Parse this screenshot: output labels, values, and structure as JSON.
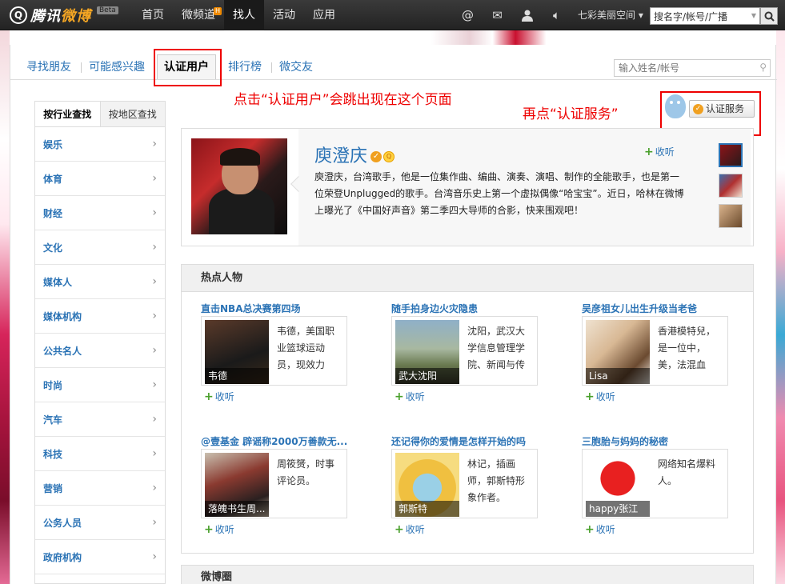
{
  "topbar": {
    "logo_text_a": "腾讯",
    "logo_text_b": "微博",
    "beta": "Beta",
    "nav": [
      {
        "label": "首页"
      },
      {
        "label": "微频道",
        "badge": "H"
      },
      {
        "label": "找人",
        "active": true
      },
      {
        "label": "活动"
      },
      {
        "label": "应用"
      }
    ],
    "icons": [
      "at-icon",
      "mail-icon",
      "user-icon",
      "speaker-icon"
    ],
    "space_link": "七彩美丽空间",
    "search_value": "搜名字/帐号/广播"
  },
  "tabs": [
    {
      "label": "寻找朋友"
    },
    {
      "label": "可能感兴趣"
    },
    {
      "label": "认证用户",
      "selected": true
    },
    {
      "label": "排行榜"
    },
    {
      "label": "微交友"
    }
  ],
  "find_placeholder": "输入姓名/帐号",
  "annotations": {
    "first": "点击“认证用户”会跳出现在这个页面",
    "second": "再点“认证服务”"
  },
  "service_button": "认证服务",
  "left_menu": {
    "tabs": [
      "按行业查找",
      "按地区查找"
    ],
    "items": [
      "娱乐",
      "体育",
      "财经",
      "文化",
      "媒体人",
      "媒体机构",
      "公共名人",
      "时尚",
      "汽车",
      "科技",
      "营销",
      "公务人员",
      "政府机构"
    ]
  },
  "featured": {
    "name": "庾澄庆",
    "description": "庾澄庆，台湾歌手，他是一位集作曲、编曲、演奏、演唱、制作的全能歌手，也是第一位荣登Unplugged的歌手。台湾音乐史上第一个虚拟偶像“哈宝宝”。近日，哈林在微博上曝光了《中国好声音》第二季四大导师的合影，快来围观吧！",
    "follow": "收听"
  },
  "hot": {
    "title": "热点人物",
    "cards": [
      {
        "title": "直击NBA总决赛第四场",
        "caption": "韦德",
        "text": "韦德，美国职业篮球运动员，现效力",
        "follow": "收听"
      },
      {
        "title": "随手拍身边火灾隐患",
        "caption": "武大沈阳",
        "text": "沈阳，武汉大学信息管理学院、新闻与传",
        "follow": "收听"
      },
      {
        "title": "吴彦祖女儿出生升级当老爸",
        "caption": "Lisa",
        "text": "香港模特兒，是一位中，美，法混血",
        "follow": "收听"
      },
      {
        "title": "@壹基金 辟谣称2000万善款无...",
        "caption": "落魄书生周...",
        "text": "周筱赟，时事评论员。",
        "follow": "收听"
      },
      {
        "title": "还记得你的爱情是怎样开始的吗",
        "caption": "郭斯特",
        "text": "林记，插画师，郭斯特形象作者。",
        "follow": "收听"
      },
      {
        "title": "三胞胎与妈妈的秘密",
        "caption": "happy张江",
        "text": "网络知名爆料人。",
        "follow": "收听"
      }
    ]
  },
  "bottom_section": "微博圈",
  "colors": {
    "link": "#2b73b5",
    "accent": "#f08a00",
    "annotation": "#e00000",
    "topbar": "#2b2b2b"
  }
}
